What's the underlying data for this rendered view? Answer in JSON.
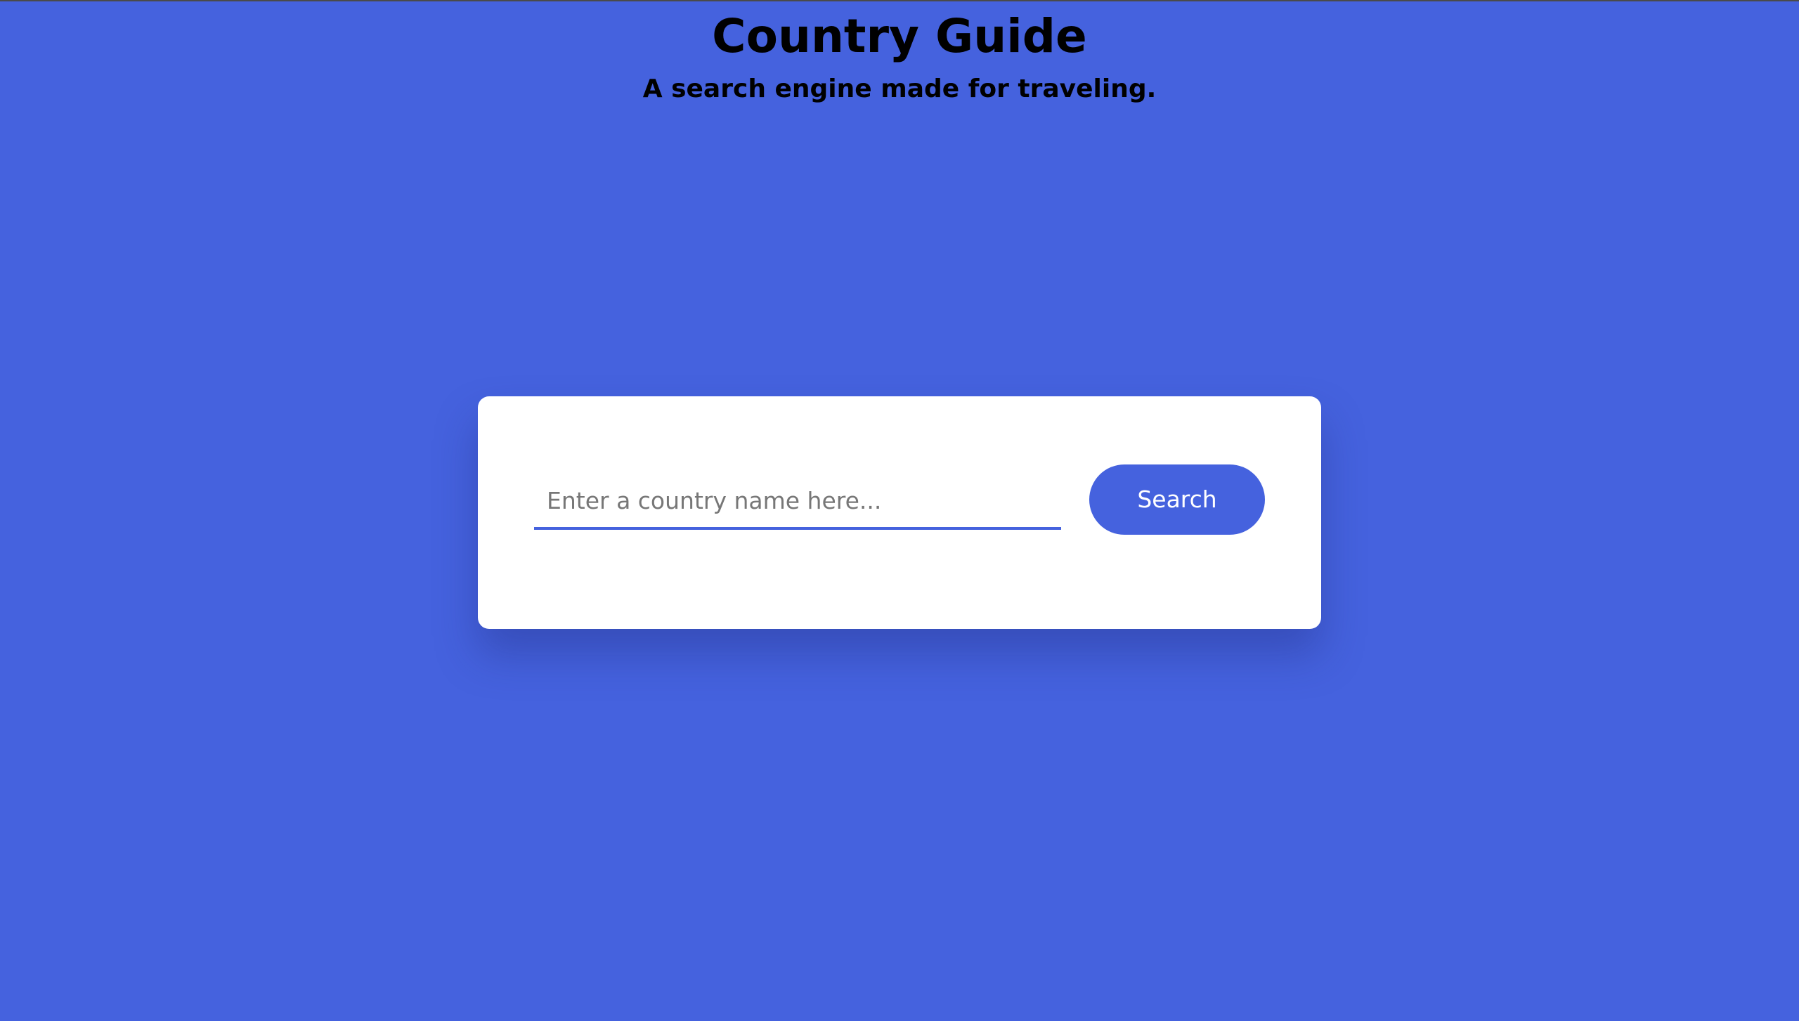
{
  "header": {
    "title": "Country Guide",
    "subtitle": "A search engine made for traveling."
  },
  "search": {
    "value": "",
    "placeholder": "Enter a country name here...",
    "button_label": "Search"
  },
  "colors": {
    "background": "#4562de",
    "card": "#ffffff",
    "accent": "#4562de",
    "title_text": "#000000",
    "button_text": "#ffffff"
  }
}
